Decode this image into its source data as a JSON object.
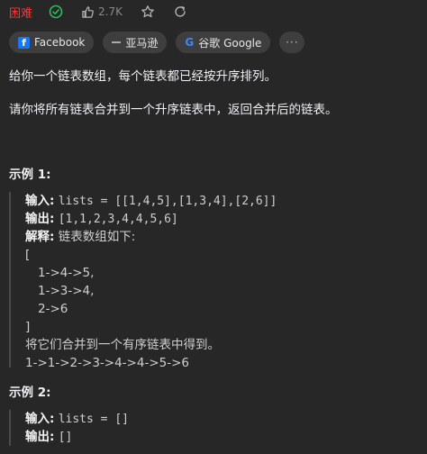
{
  "header": {
    "difficulty": "困难",
    "like_count": "2.7K"
  },
  "tags": [
    {
      "label": "Facebook",
      "icon": "facebook-icon"
    },
    {
      "label": "亚马逊",
      "icon": "amazon-icon"
    },
    {
      "label": "谷歌 Google",
      "icon": "google-icon"
    },
    {
      "label": "···",
      "icon": "more-icon"
    }
  ],
  "description": {
    "p1": "给你一个链表数组，每个链表都已经按升序排列。",
    "p2": "请你将所有链表合并到一个升序链表中，返回合并后的链表。"
  },
  "example1": {
    "title": "示例 1:",
    "input_label": "输入:",
    "input_value": "lists = [[1,4,5],[1,3,4],[2,6]]",
    "output_label": "输出:",
    "output_value": "[1,1,2,3,4,4,5,6]",
    "explain_label": "解释:",
    "explain_value": "链表数组如下:",
    "lines": [
      "[",
      "1->4->5,",
      "1->3->4,",
      "2->6",
      "]"
    ],
    "merge_text": "将它们合并到一个有序链表中得到。",
    "result": "1->1->2->3->4->4->5->6"
  },
  "example2": {
    "title": "示例 2:",
    "input_label": "输入:",
    "input_value": "lists = []",
    "output_label": "输出:",
    "output_value": "[]"
  }
}
